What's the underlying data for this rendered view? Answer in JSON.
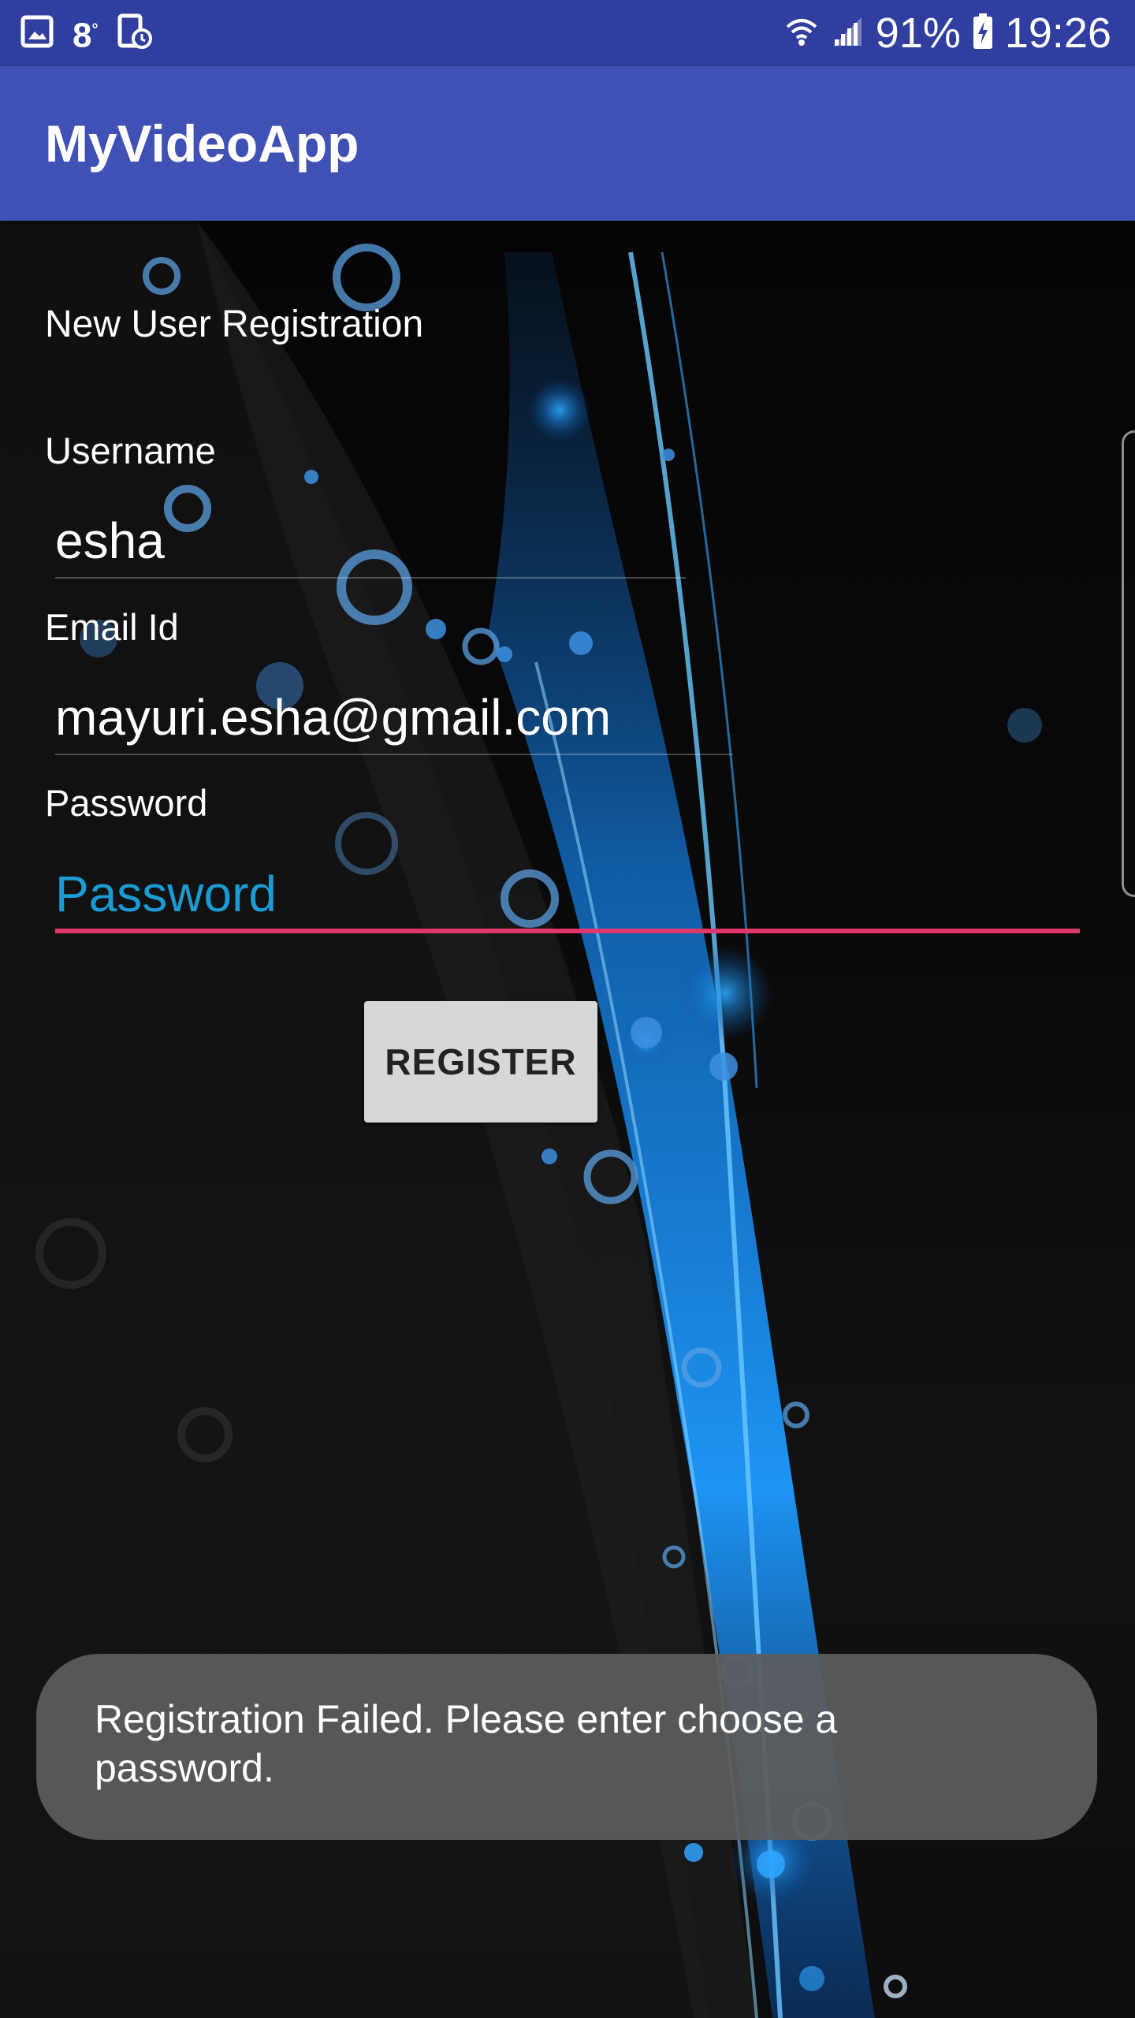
{
  "status_bar": {
    "temperature": "8",
    "temperature_unit": "°",
    "battery": "91%",
    "time": "19:26",
    "icons": [
      "gallery-icon",
      "device-clock-icon",
      "wifi-icon",
      "signal-icon",
      "battery-charging-icon"
    ]
  },
  "app_bar": {
    "title": "MyVideoApp"
  },
  "form": {
    "heading": "New User Registration",
    "username_label": "Username",
    "username_value": "esha",
    "email_label": "Email Id",
    "email_value": "mayuri.esha@gmail.com",
    "password_label": "Password",
    "password_placeholder": "Password",
    "register_label": "REGISTER"
  },
  "toast": {
    "message": "Registration Failed. Please enter choose a password."
  },
  "colors": {
    "status_bar": "#303f9f",
    "app_bar": "#3f51b5",
    "accent_underline": "#e0386a",
    "hint_text": "#1a9bd4",
    "button": "#d6d7d7"
  }
}
